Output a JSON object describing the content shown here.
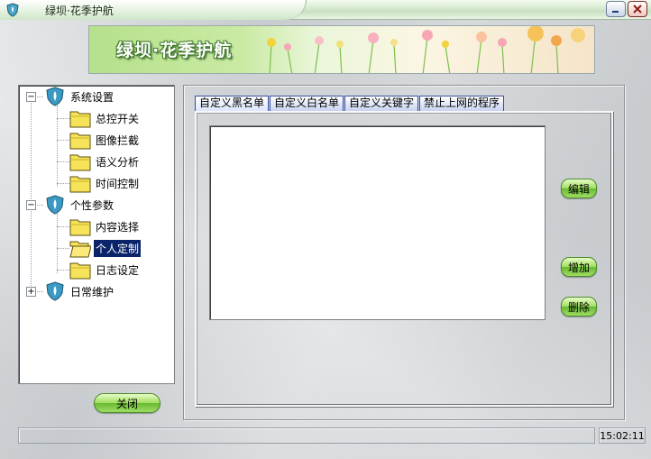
{
  "window": {
    "title": "绿坝·花季护航"
  },
  "banner": {
    "title": "绿坝·花季护航"
  },
  "tree": {
    "groups": [
      {
        "label": "系统设置",
        "expander": "−",
        "children": [
          "总控开关",
          "图像拦截",
          "语义分析",
          "时间控制"
        ]
      },
      {
        "label": "个性参数",
        "expander": "−",
        "children": [
          "内容选择",
          "个人定制",
          "日志设定"
        ]
      },
      {
        "label": "日常维护",
        "expander": "+",
        "children": []
      }
    ],
    "selected": "个人定制"
  },
  "tabs": [
    "自定义黑名单",
    "自定义白名单",
    "自定义关键字",
    "禁止上网的程序"
  ],
  "buttons": {
    "edit": "编辑",
    "add": "增加",
    "delete": "删除",
    "close": "关闭"
  },
  "status": {
    "time": "15:02:11"
  },
  "colors": {
    "selection": "#0a246a",
    "button_green": "#9fdd5e",
    "tab_border": "#3a4fa0"
  }
}
